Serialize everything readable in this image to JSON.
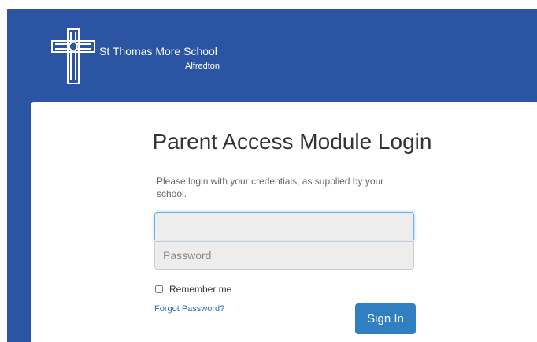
{
  "header": {
    "school_name": "St Thomas More School",
    "school_town": "Alfredton",
    "logo_icon": "cross-crest-icon"
  },
  "login": {
    "title": "Parent Access Module Login",
    "instructions": "Please login with your credentials, as supplied by your school.",
    "username_value": "",
    "username_placeholder": "",
    "password_placeholder": "Password",
    "remember_label": "Remember me",
    "remember_checked": false,
    "forgot_label": "Forgot Password?",
    "signin_label": "Sign In"
  },
  "colors": {
    "background_blue": "#2b55a3",
    "button_blue": "#2f7fc1",
    "link_blue": "#2a6dbe"
  }
}
